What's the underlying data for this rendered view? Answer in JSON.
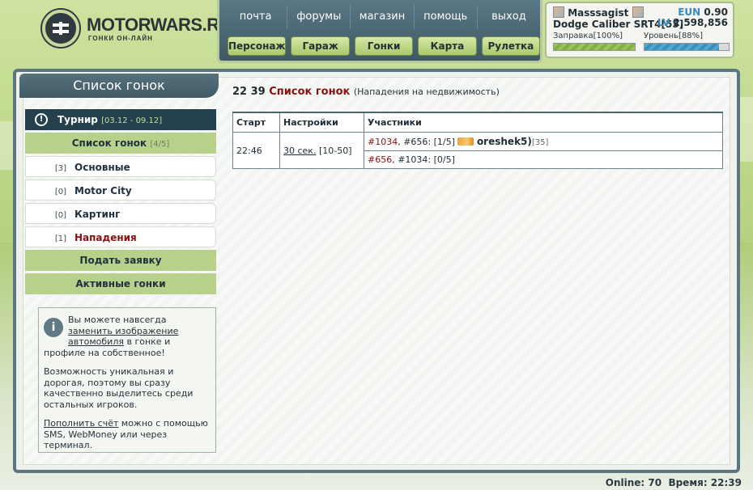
{
  "logo": {
    "title": "MOTORWARS.RU",
    "subtitle": "ГОНКИ ОН-ЛАЙН"
  },
  "nav": {
    "links": [
      "почта",
      "форумы",
      "магазин",
      "помощь",
      "выход"
    ],
    "buttons": [
      "Персонаж",
      "Гараж",
      "Гонки",
      "Карта",
      "Рулетка"
    ]
  },
  "user": {
    "name": "Masssagist",
    "car": "Dodge Caliber SRT4[55]",
    "eun_label": "EUN",
    "eun_value": "0.90",
    "lv_label": "LV",
    "lv_value": "2,598,856",
    "fuel_label": "Заправка[100%]",
    "fuel_percent": 100,
    "level_label": "Уровень[88%]",
    "level_percent": 88
  },
  "sidebar": {
    "header": "Список гонок",
    "tournament": {
      "label": "Турнир",
      "dates": "[03.12 - 09.12]"
    },
    "race_list": {
      "label": "Список гонок",
      "count": "[4/5]"
    },
    "items": [
      {
        "count": "[3]",
        "label": "Основные"
      },
      {
        "count": "[0]",
        "label": "Motor City"
      },
      {
        "count": "[0]",
        "label": "Картинг"
      },
      {
        "count": "[1]",
        "label": "Нападения"
      }
    ],
    "submit": "Подать заявку",
    "active": "Активные гонки"
  },
  "info": {
    "p1_a": "Вы можете навсегда ",
    "p1_link": "заменить изображение автомобиля",
    "p1_b": " в гонке и профиле на собственное!",
    "p2": "Возможность уникальная и дорогая, поэтому вы сразу качественно выделитесь среди остальных игроков.",
    "p3_link": "Пополнить счёт",
    "p3_b": " можно с помощью SMS, WebMoney или через терминал."
  },
  "content": {
    "time": "22 39",
    "title": "Список гонок",
    "subtitle": "(Нападения на недвижимость)",
    "columns": [
      "Старт",
      "Настройки",
      "Участники"
    ],
    "row": {
      "start": "22:46",
      "settings_link": "30 сек.",
      "settings_range": "[10-50]",
      "p1_a": "#1034",
      "p1_b": "#656",
      "p1_slots": ": [1/5]",
      "p1_player": "oreshek5)",
      "p1_level": "[35]",
      "p2_a": "#656",
      "p2_b": "#1034",
      "p2_slots": ": [0/5]"
    }
  },
  "footer": {
    "online": "Online: 70",
    "time": "Время: 22:39"
  }
}
